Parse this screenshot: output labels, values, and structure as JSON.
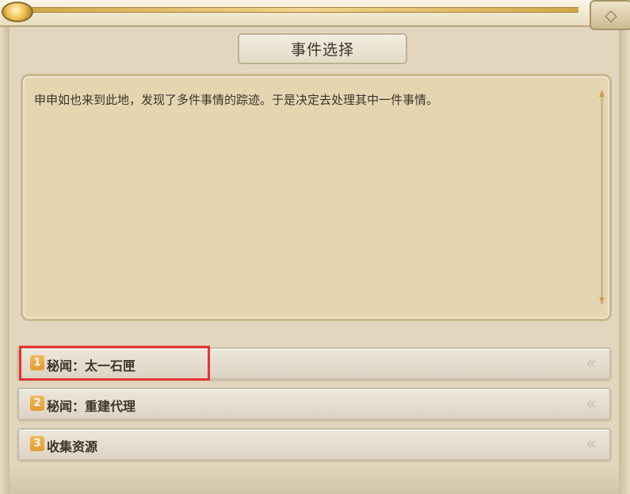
{
  "dialog": {
    "title": "事件选择",
    "close_icon": "close-icon"
  },
  "description": {
    "text": "申申如也来到此地，发现了多件事情的踪迹。于是决定去处理其中一件事情。"
  },
  "options": [
    {
      "number": "1",
      "label": "秘闻：太一石匣",
      "highlighted": true
    },
    {
      "number": "2",
      "label": "秘闻：重建代理",
      "highlighted": false
    },
    {
      "number": "3",
      "label": "收集资源",
      "highlighted": false
    }
  ],
  "colors": {
    "highlight": "#e8332f",
    "number_badge": "#e9a33c",
    "panel": "#e2d7be"
  }
}
